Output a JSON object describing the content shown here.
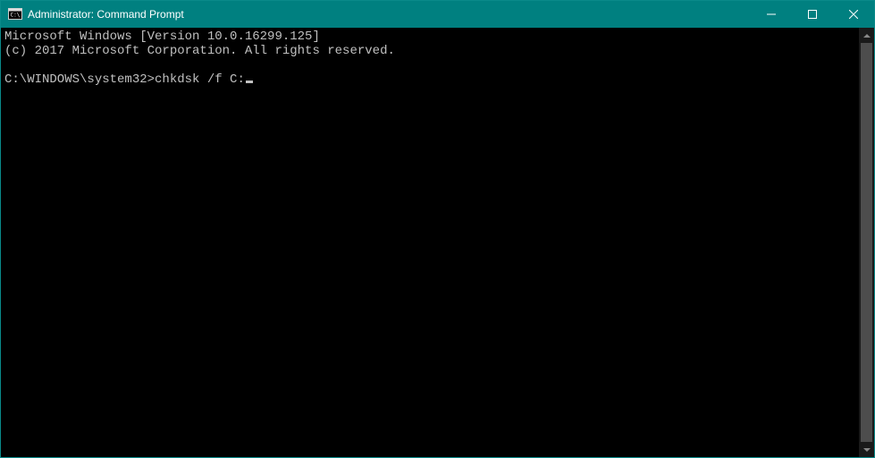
{
  "window": {
    "title": "Administrator: Command Prompt"
  },
  "terminal": {
    "line1": "Microsoft Windows [Version 10.0.16299.125]",
    "line2": "(c) 2017 Microsoft Corporation. All rights reserved.",
    "blank": "",
    "prompt": "C:\\WINDOWS\\system32>",
    "command": "chkdsk /f C:"
  }
}
